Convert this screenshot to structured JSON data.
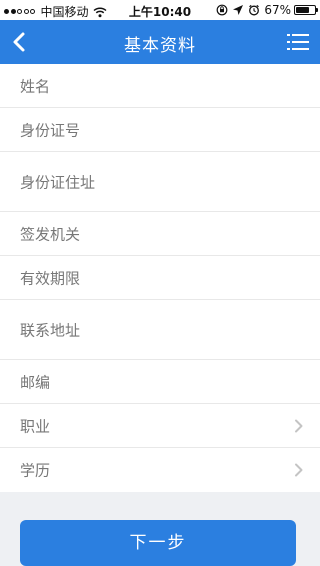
{
  "status_bar": {
    "carrier": "中国移动",
    "time": "上午10:40",
    "battery": "67%"
  },
  "nav": {
    "title": "基本资料",
    "back_icon": "chevron-left-icon",
    "menu_icon": "list-icon"
  },
  "form": {
    "rows": [
      {
        "label": "姓名"
      },
      {
        "label": "身份证号"
      },
      {
        "label": "身份证住址"
      },
      {
        "label": "签发机关"
      },
      {
        "label": "有效期限"
      },
      {
        "label": "联系地址"
      },
      {
        "label": "邮编"
      },
      {
        "label": "职业"
      },
      {
        "label": "学历"
      }
    ]
  },
  "next_button": {
    "label": "下一步"
  },
  "colors": {
    "accent": "#2b7fe0",
    "background": "#eef0f3",
    "label": "#777777"
  }
}
